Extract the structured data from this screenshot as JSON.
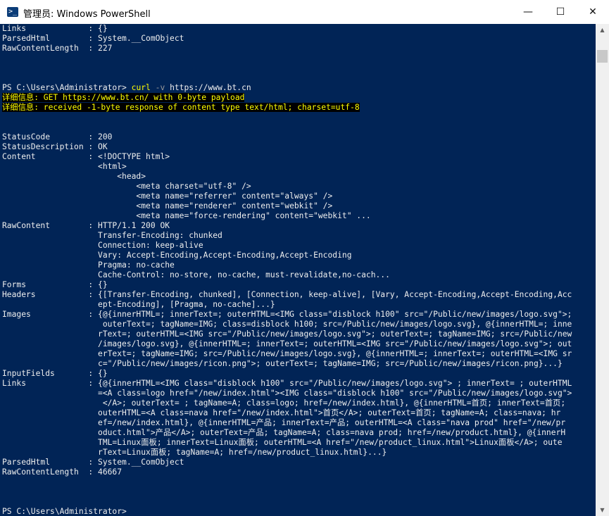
{
  "window": {
    "title": "管理员: Windows PowerShell",
    "app_icon": "powershell-icon",
    "minimize_glyph": "—",
    "maximize_glyph": "☐",
    "close_glyph": "✕"
  },
  "console": {
    "background": "#012456",
    "foreground": "#eeeeee",
    "warning_color": "#ffff00",
    "lines": [
      {
        "t": "Links             : {}"
      },
      {
        "t": "ParsedHtml        : System.__ComObject"
      },
      {
        "t": "RawContentLength  : 227"
      },
      {
        "t": ""
      },
      {
        "t": ""
      },
      {
        "t": ""
      },
      {
        "k": "cmd",
        "p1": "PS C:\\Users\\Administrator> ",
        "p2": "curl",
        "p3": " -v",
        "p4": " https://www.bt.cn"
      },
      {
        "k": "warn",
        "t": "详细信息: GET https://www.bt.cn/ with 0-byte payload"
      },
      {
        "k": "warn",
        "t": "详细信息: received -1-byte response of content type text/html; charset=utf-8"
      },
      {
        "t": ""
      },
      {
        "t": ""
      },
      {
        "t": "StatusCode        : 200"
      },
      {
        "t": "StatusDescription : OK"
      },
      {
        "t": "Content           : <!DOCTYPE html>"
      },
      {
        "t": "                    <html>"
      },
      {
        "t": "                        <head>"
      },
      {
        "t": "                            <meta charset=\"utf-8\" />"
      },
      {
        "t": "                            <meta name=\"referrer\" content=\"always\" />"
      },
      {
        "t": "                            <meta name=\"renderer\" content=\"webkit\" />"
      },
      {
        "t": "                            <meta name=\"force-rendering\" content=\"webkit\" ..."
      },
      {
        "t": "RawContent        : HTTP/1.1 200 OK"
      },
      {
        "t": "                    Transfer-Encoding: chunked"
      },
      {
        "t": "                    Connection: keep-alive"
      },
      {
        "t": "                    Vary: Accept-Encoding,Accept-Encoding,Accept-Encoding"
      },
      {
        "t": "                    Pragma: no-cache"
      },
      {
        "t": "                    Cache-Control: no-store, no-cache, must-revalidate,no-cach..."
      },
      {
        "t": "Forms             : {}"
      },
      {
        "t": "Headers           : {[Transfer-Encoding, chunked], [Connection, keep-alive], [Vary, Accept-Encoding,Accept-Encoding,Acc"
      },
      {
        "t": "                    ept-Encoding], [Pragma, no-cache]...}"
      },
      {
        "t": "Images            : {@{innerHTML=; innerText=; outerHTML=<IMG class=\"disblock h100\" src=\"/Public/new/images/logo.svg\">;"
      },
      {
        "t": "                     outerText=; tagName=IMG; class=disblock h100; src=/Public/new/images/logo.svg}, @{innerHTML=; inne"
      },
      {
        "t": "                    rText=; outerHTML=<IMG src=\"/Public/new/images/logo.svg\">; outerText=; tagName=IMG; src=/Public/new"
      },
      {
        "t": "                    /images/logo.svg}, @{innerHTML=; innerText=; outerHTML=<IMG src=\"/Public/new/images/logo.svg\">; out"
      },
      {
        "t": "                    erText=; tagName=IMG; src=/Public/new/images/logo.svg}, @{innerHTML=; innerText=; outerHTML=<IMG sr"
      },
      {
        "t": "                    c=\"/Public/new/images/ricon.png\">; outerText=; tagName=IMG; src=/Public/new/images/ricon.png}...}"
      },
      {
        "t": "InputFields       : {}"
      },
      {
        "t": "Links             : {@{innerHTML=<IMG class=\"disblock h100\" src=\"/Public/new/images/logo.svg\"> ; innerText= ; outerHTML"
      },
      {
        "t": "                    =<A class=logo href=\"/new/index.html\"><IMG class=\"disblock h100\" src=\"/Public/new/images/logo.svg\">"
      },
      {
        "t": "                     </A>; outerText= ; tagName=A; class=logo; href=/new/index.html}, @{innerHTML=首页; innerText=首页;"
      },
      {
        "t": "                    outerHTML=<A class=nava href=\"/new/index.html\">首页</A>; outerText=首页; tagName=A; class=nava; hr"
      },
      {
        "t": "                    ef=/new/index.html}, @{innerHTML=产品; innerText=产品; outerHTML=<A class=\"nava prod\" href=\"/new/pr"
      },
      {
        "t": "                    oduct.html\">产品</A>; outerText=产品; tagName=A; class=nava prod; href=/new/product.html}, @{innerH"
      },
      {
        "t": "                    TML=Linux面板; innerText=Linux面板; outerHTML=<A href=\"/new/product_linux.html\">Linux面板</A>; oute"
      },
      {
        "t": "                    rText=Linux面板; tagName=A; href=/new/product_linux.html}...}"
      },
      {
        "t": "ParsedHtml        : System.__ComObject"
      },
      {
        "t": "RawContentLength  : 46667"
      },
      {
        "t": ""
      },
      {
        "t": ""
      },
      {
        "t": ""
      },
      {
        "k": "prompt",
        "t": "PS C:\\Users\\Administrator> "
      }
    ]
  },
  "scrollbar": {
    "up_glyph": "▲",
    "down_glyph": "▼"
  }
}
